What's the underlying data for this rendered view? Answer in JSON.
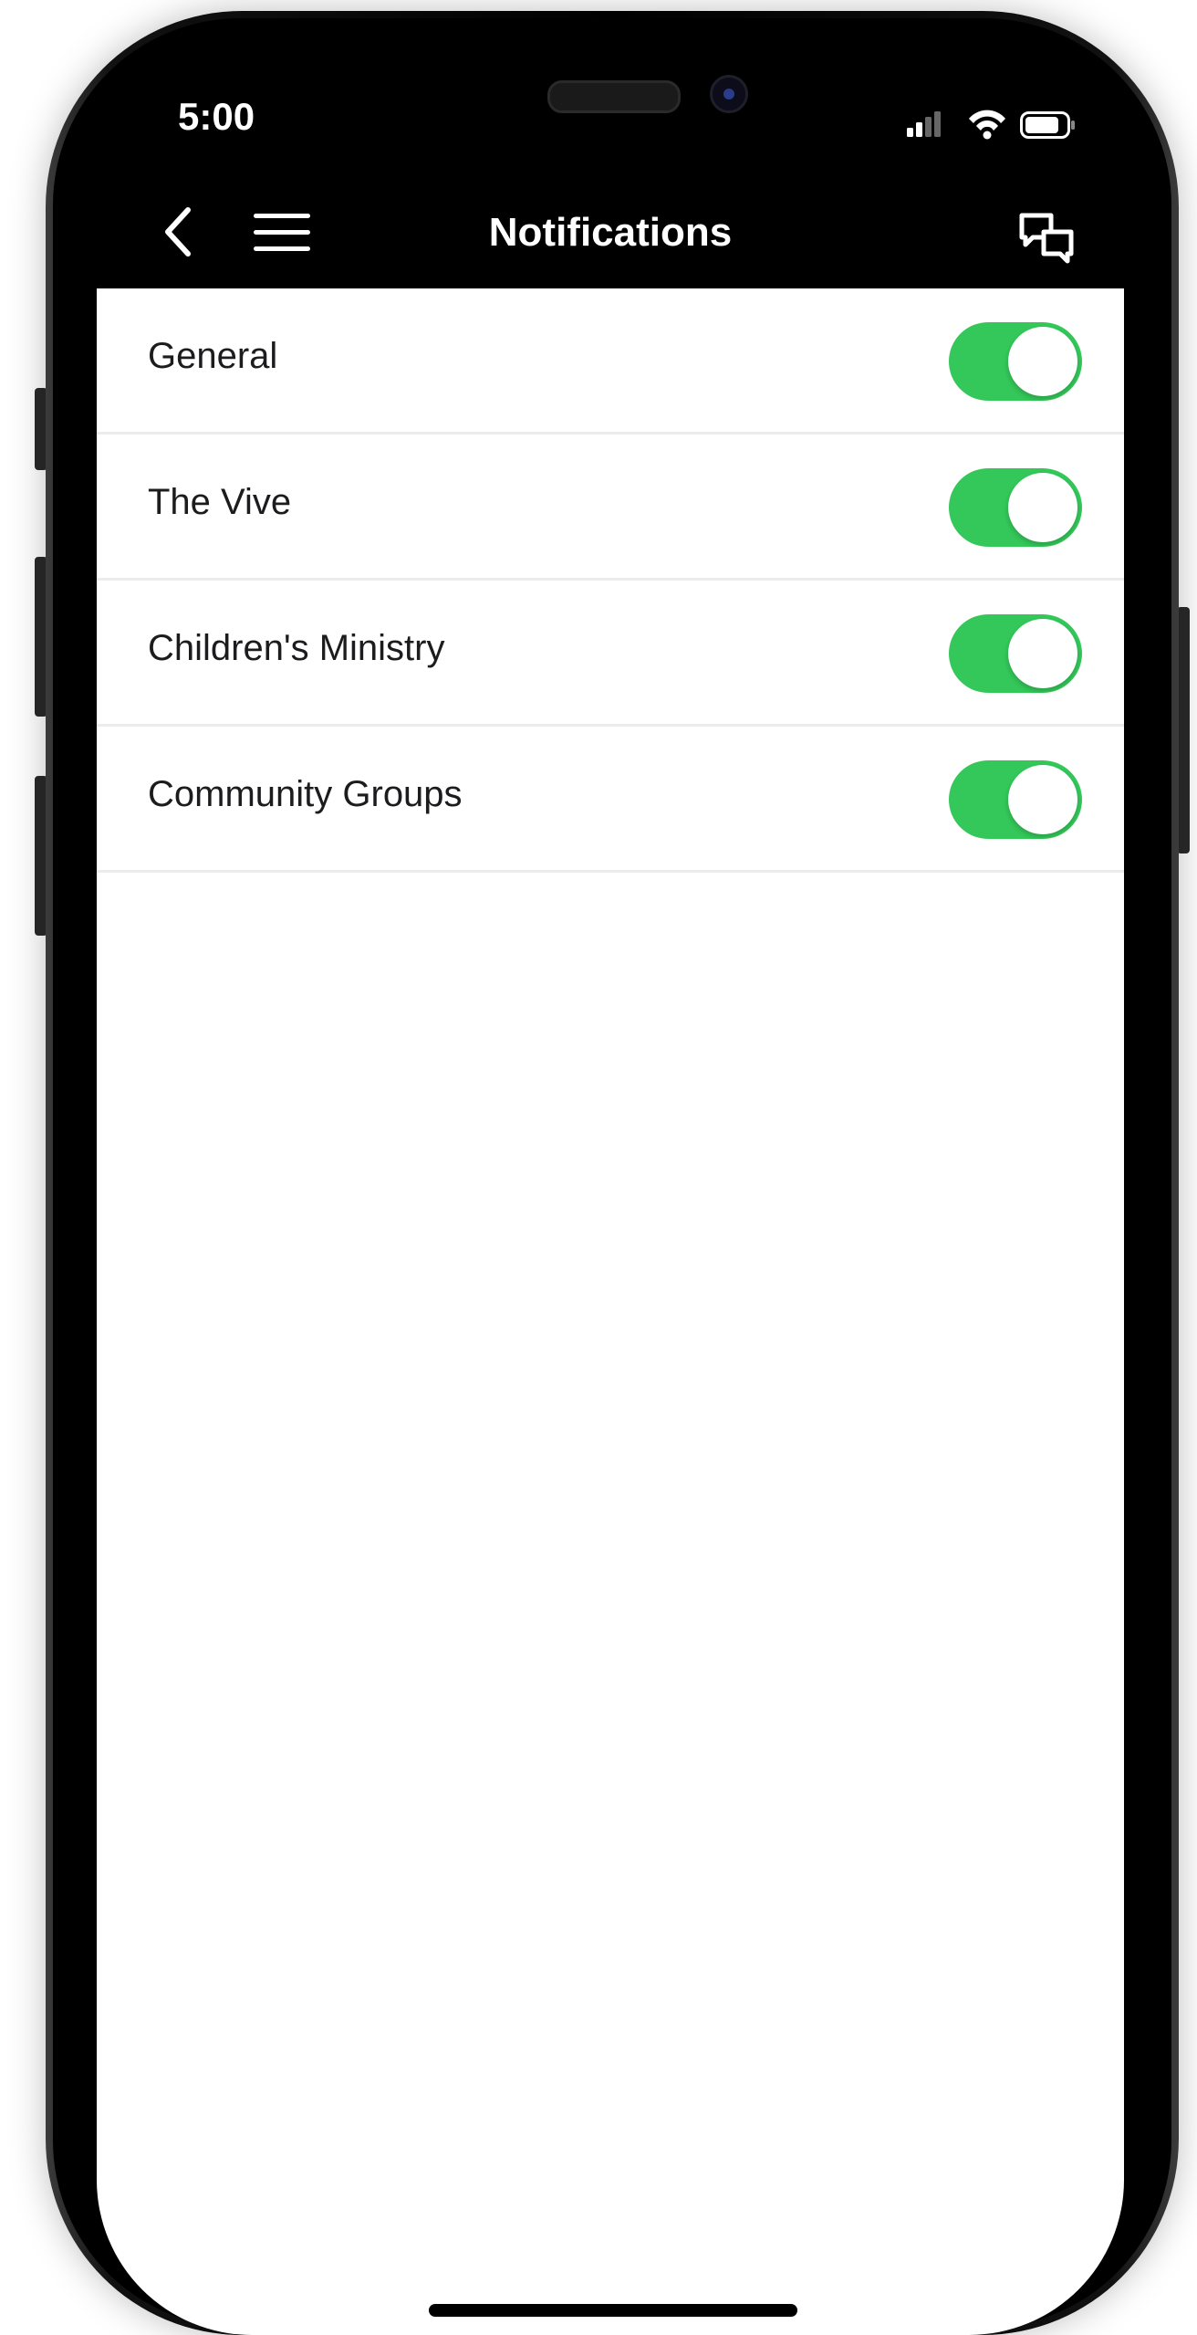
{
  "status_bar": {
    "time": "5:00"
  },
  "nav": {
    "title": "Notifications"
  },
  "settings": {
    "items": [
      {
        "label": "General",
        "enabled": true
      },
      {
        "label": "The Vive",
        "enabled": true
      },
      {
        "label": "Children's Ministry",
        "enabled": true
      },
      {
        "label": "Community Groups",
        "enabled": true
      }
    ]
  },
  "colors": {
    "toggle_on": "#34c759",
    "nav_background": "#000000",
    "screen_background": "#ffffff"
  },
  "icons": {
    "back": "chevron-left-icon",
    "menu": "hamburger-menu-icon",
    "chat": "chat-bubbles-icon",
    "signal": "cellular-signal-icon",
    "wifi": "wifi-icon",
    "battery": "battery-icon"
  }
}
